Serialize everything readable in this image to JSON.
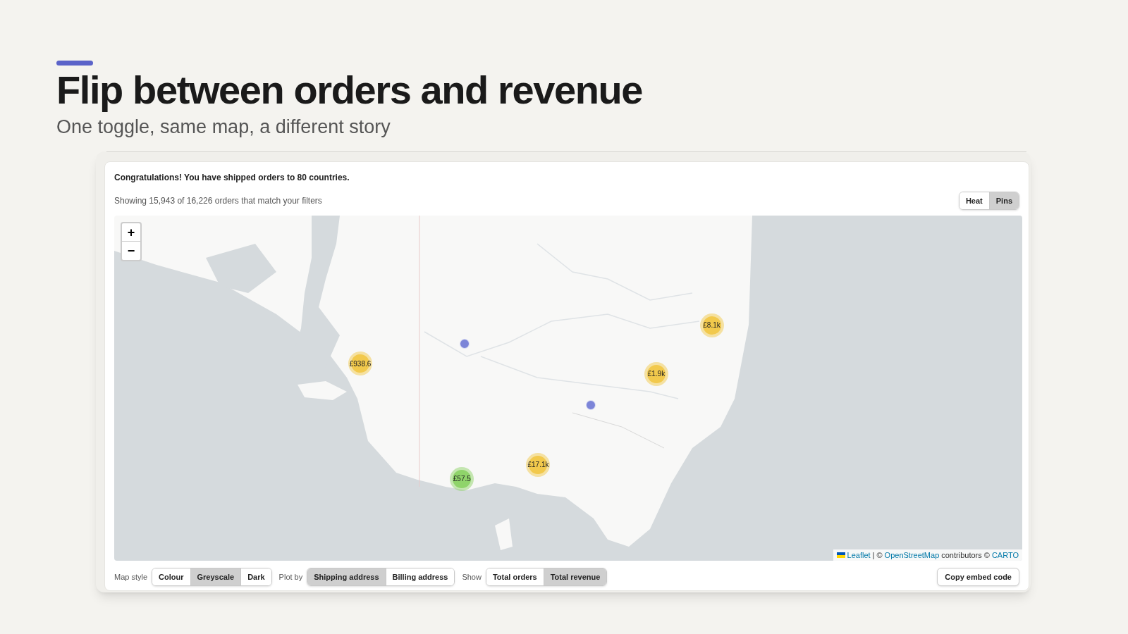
{
  "heading": {
    "title": "Flip between orders and revenue",
    "subtitle": "One toggle, same map, a different story"
  },
  "card": {
    "message": "Congratulations! You have shipped orders to 80 countries.",
    "summary": "Showing 15,943 of 16,226 orders that match your filters",
    "view_toggle": [
      {
        "label": "Heat",
        "selected": false
      },
      {
        "label": "Pins",
        "selected": true
      }
    ]
  },
  "map": {
    "zoom_in": "+",
    "zoom_out": "−",
    "markers": [
      {
        "kind": "cluster",
        "label": "£938.6",
        "color": "#f2c94c"
      },
      {
        "kind": "cluster",
        "label": "£8.1k",
        "color": "#f2c94c"
      },
      {
        "kind": "cluster",
        "label": "£1.9k",
        "color": "#f2c94c"
      },
      {
        "kind": "cluster",
        "label": "£17.1k",
        "color": "#f2c94c"
      },
      {
        "kind": "cluster",
        "label": "£57.5",
        "color": "#8fd46a"
      },
      {
        "kind": "point",
        "color": "#7c85d8"
      },
      {
        "kind": "point",
        "color": "#7c85d8"
      }
    ],
    "attribution": [
      {
        "kind": "link",
        "text": "Leaflet"
      },
      {
        "kind": "text",
        "text": "| ©"
      },
      {
        "kind": "link",
        "text": "OpenStreetMap"
      },
      {
        "kind": "text",
        "text": "contributors ©"
      },
      {
        "kind": "link",
        "text": "CARTO"
      }
    ]
  },
  "controls": [
    {
      "label": "Map style",
      "options": [
        {
          "label": "Colour",
          "selected": false
        },
        {
          "label": "Greyscale",
          "selected": true
        },
        {
          "label": "Dark",
          "selected": false
        }
      ]
    },
    {
      "label": "Plot by",
      "options": [
        {
          "label": "Shipping address",
          "selected": true
        },
        {
          "label": "Billing address",
          "selected": false
        }
      ]
    },
    {
      "label": "Show",
      "options": [
        {
          "label": "Total orders",
          "selected": false
        },
        {
          "label": "Total revenue",
          "selected": true
        }
      ]
    }
  ],
  "embed_button": "Copy embed code"
}
